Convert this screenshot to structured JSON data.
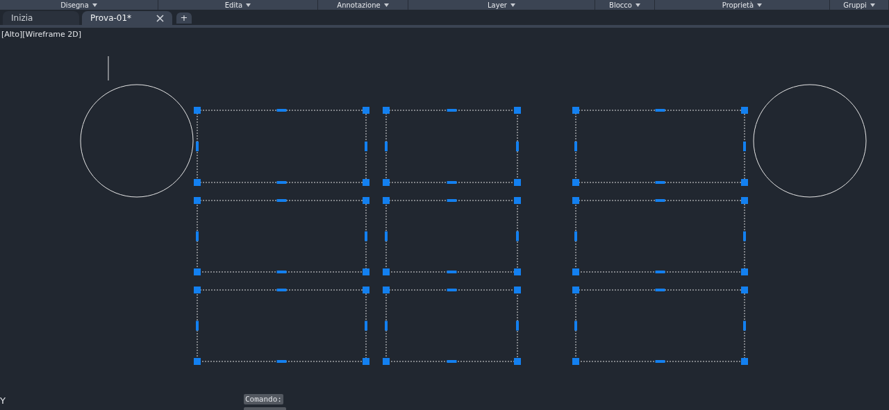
{
  "ribbon_panels": [
    {
      "label": "Disegna"
    },
    {
      "label": "Edita"
    },
    {
      "label": "Annotazione"
    },
    {
      "label": "Layer"
    },
    {
      "label": "Blocco"
    },
    {
      "label": "Proprietà"
    },
    {
      "label": "Gruppi"
    }
  ],
  "tabs": [
    {
      "label": "Inizia",
      "selected": false
    },
    {
      "label": "Prova-01*",
      "selected": true
    }
  ],
  "new_tab": "+",
  "viewport": {
    "label": "[Alto][Wireframe 2D]",
    "axis_label": "Y",
    "objects_selected": true
  },
  "command_line": {
    "prompt": "Comando:"
  }
}
